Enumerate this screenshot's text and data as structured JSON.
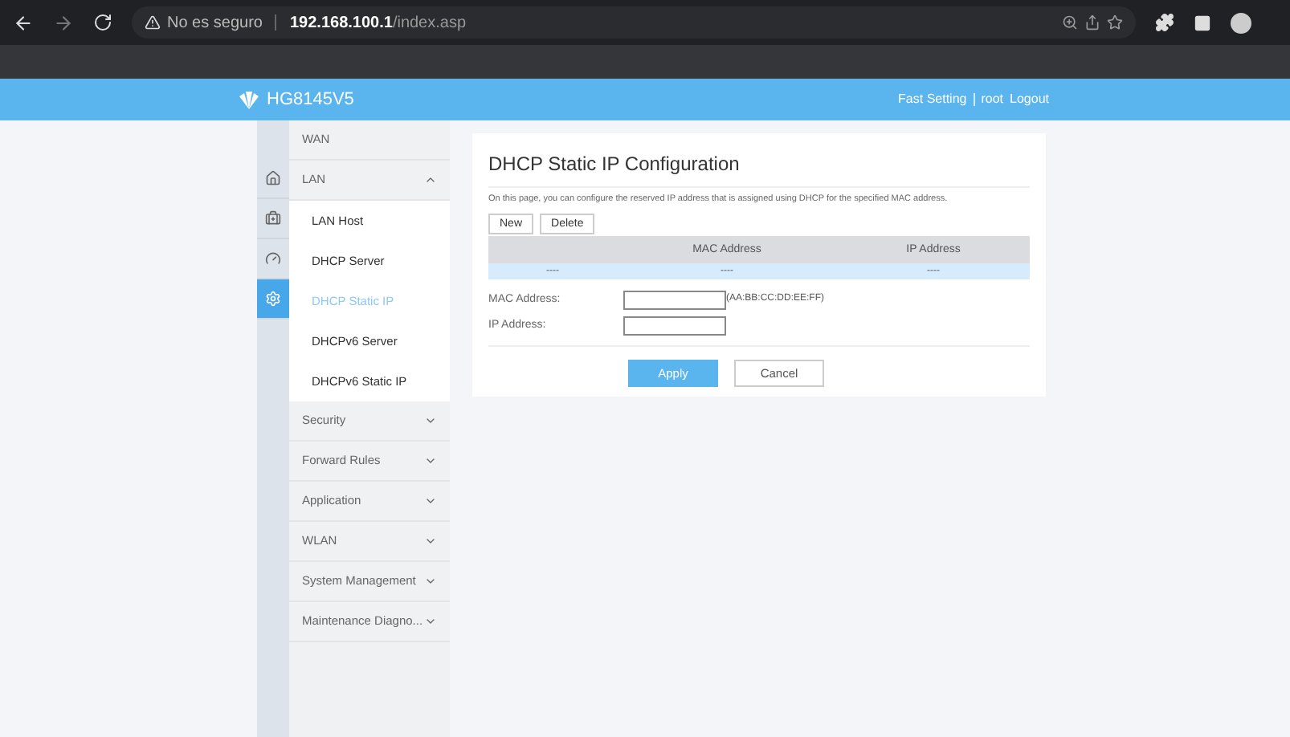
{
  "browser": {
    "security": "No es seguro",
    "url_host": "192.168.100.1",
    "url_path": "/index.asp"
  },
  "header": {
    "model": "HG8145V5",
    "links": [
      "Fast Setting",
      "root",
      "Logout"
    ]
  },
  "rail": [
    {
      "kind": "home",
      "selected": false
    },
    {
      "kind": "toolbox",
      "selected": false
    },
    {
      "kind": "gauge",
      "selected": false
    },
    {
      "kind": "gear",
      "selected": true
    }
  ],
  "nav": [
    {
      "label": "WAN",
      "kind": "plain"
    },
    {
      "label": "LAN",
      "kind": "section",
      "expanded": true,
      "children": [
        {
          "label": "LAN Host",
          "selected": false
        },
        {
          "label": "DHCP Server",
          "selected": false
        },
        {
          "label": "DHCP Static IP",
          "selected": true
        },
        {
          "label": "DHCPv6 Server",
          "selected": false
        },
        {
          "label": "DHCPv6 Static IP",
          "selected": false
        }
      ]
    },
    {
      "label": "Security",
      "kind": "section",
      "expanded": false
    },
    {
      "label": "Forward Rules",
      "kind": "section",
      "expanded": false
    },
    {
      "label": "Application",
      "kind": "section",
      "expanded": false
    },
    {
      "label": "WLAN",
      "kind": "section",
      "expanded": false
    },
    {
      "label": "System Management",
      "kind": "section",
      "expanded": false
    },
    {
      "label": "Maintenance Diagno...",
      "kind": "section",
      "expanded": false
    }
  ],
  "page": {
    "title": "DHCP Static IP Configuration",
    "description": "On this page, you can configure the reserved IP address that is assigned using DHCP for the specified MAC address.",
    "buttons": [
      "New",
      "Delete"
    ],
    "table": {
      "columns": [
        "",
        "MAC Address",
        "IP Address"
      ],
      "rows": [
        [
          "----",
          "----",
          "----"
        ]
      ]
    },
    "form": [
      {
        "label": "MAC Address:",
        "hint": "(AA:BB:CC:DD:EE:FF)"
      },
      {
        "label": "IP Address:"
      }
    ],
    "actions": [
      "Apply",
      "Cancel"
    ]
  }
}
